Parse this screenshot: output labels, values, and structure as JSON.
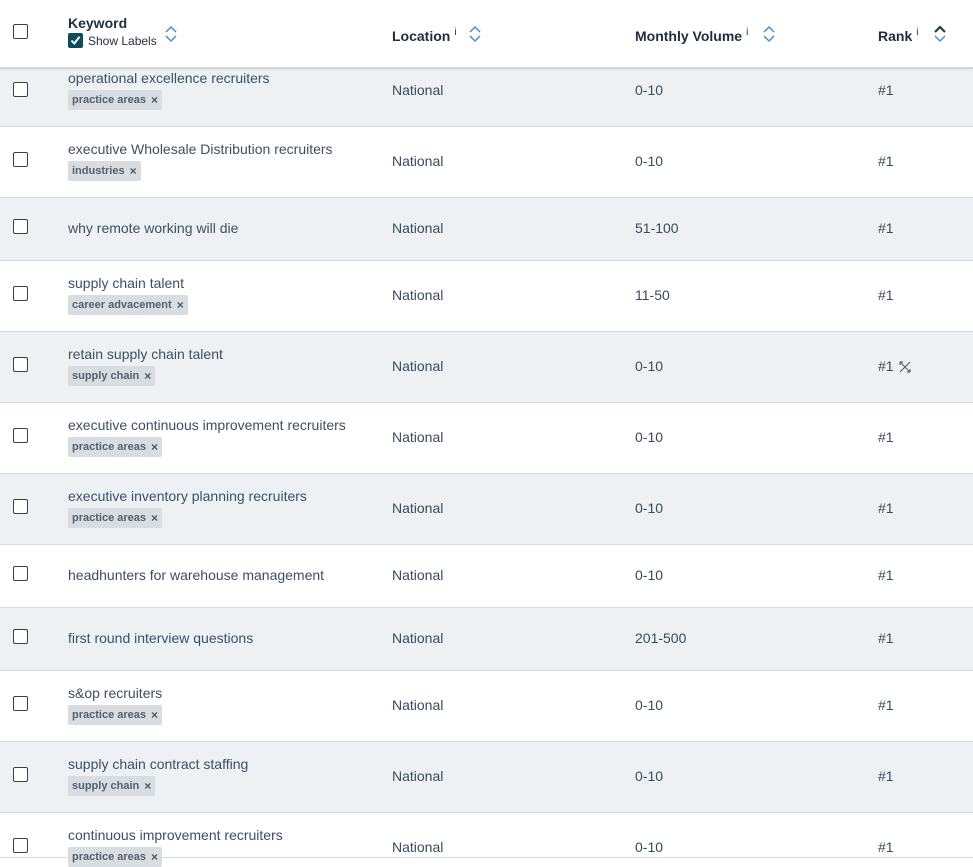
{
  "header": {
    "keyword_title": "Keyword",
    "show_labels": "Show Labels",
    "location_title": "Location",
    "volume_title": "Monthly Volume",
    "rank_title": "Rank",
    "info_mark": "i"
  },
  "rows": [
    {
      "keyword": "operational excellence recruiters",
      "tag": "practice areas",
      "location": "National",
      "volume": "0-10",
      "rank": "#1"
    },
    {
      "keyword": "executive Wholesale Distribution recruiters",
      "tag": "industries",
      "location": "National",
      "volume": "0-10",
      "rank": "#1"
    },
    {
      "keyword": "why remote working will die",
      "tag": null,
      "location": "National",
      "volume": "51-100",
      "rank": "#1"
    },
    {
      "keyword": "supply chain talent",
      "tag": "career advacement",
      "location": "National",
      "volume": "11-50",
      "rank": "#1"
    },
    {
      "keyword": "retain supply chain talent",
      "tag": "supply chain",
      "location": "National",
      "volume": "0-10",
      "rank": "#1"
    },
    {
      "keyword": "executive continuous improvement recruiters",
      "tag": "practice areas",
      "location": "National",
      "volume": "0-10",
      "rank": "#1"
    },
    {
      "keyword": "executive inventory planning recruiters",
      "tag": "practice areas",
      "location": "National",
      "volume": "0-10",
      "rank": "#1"
    },
    {
      "keyword": "headhunters for warehouse management",
      "tag": null,
      "location": "National",
      "volume": "0-10",
      "rank": "#1"
    },
    {
      "keyword": "first round interview questions",
      "tag": null,
      "location": "National",
      "volume": "201-500",
      "rank": "#1"
    },
    {
      "keyword": "s&op recruiters",
      "tag": "practice areas",
      "location": "National",
      "volume": "0-10",
      "rank": "#1"
    },
    {
      "keyword": "supply chain contract staffing",
      "tag": "supply chain",
      "location": "National",
      "volume": "0-10",
      "rank": "#1"
    },
    {
      "keyword": "continuous improvement recruiters",
      "tag": "practice areas",
      "location": "National",
      "volume": "0-10",
      "rank": "#1"
    }
  ],
  "tag_remove_glyph": "×",
  "colors": {
    "row_shaded": "#edf1f3",
    "tag_bg": "#d7dde1",
    "accent": "#0e4c5c"
  }
}
